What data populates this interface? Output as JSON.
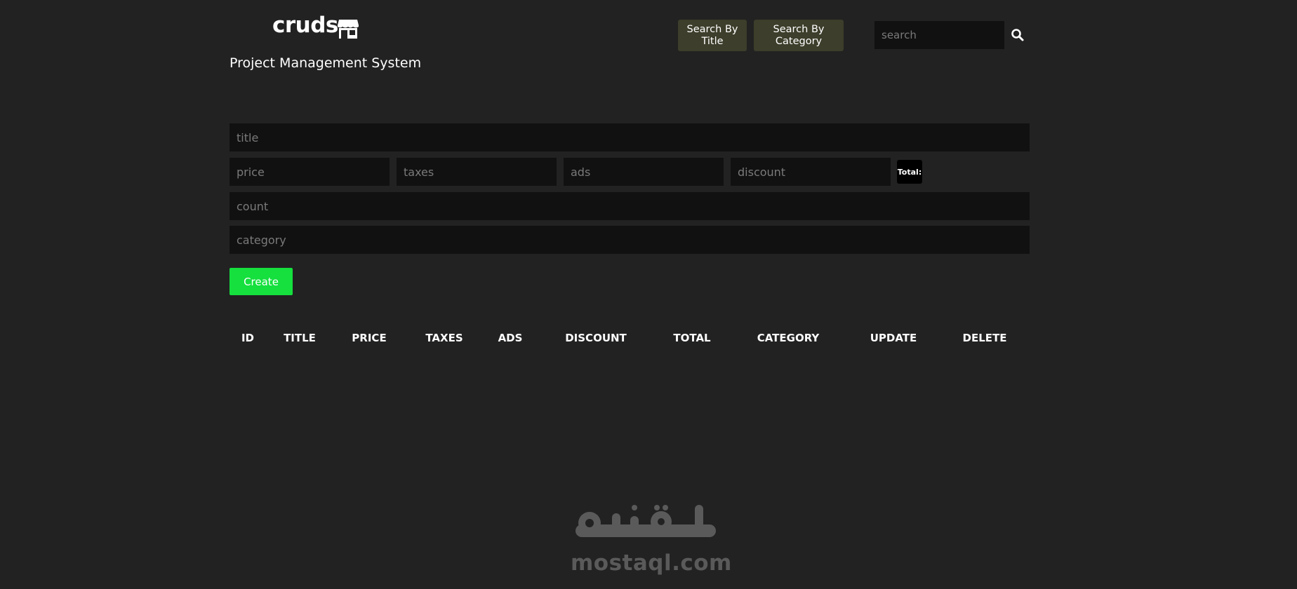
{
  "header": {
    "brand": "cruds",
    "brand_icon": "store-icon",
    "subtitle": "Project Management System",
    "search_by_title_label": "Search By\nTitle",
    "search_by_category_label": "Search By\nCategory",
    "search_placeholder": "search",
    "search_icon": "search-icon"
  },
  "form": {
    "title_placeholder": "title",
    "price_placeholder": "price",
    "taxes_placeholder": "taxes",
    "ads_placeholder": "ads",
    "discount_placeholder": "discount",
    "total_label": "Total:",
    "count_placeholder": "count",
    "category_placeholder": "category",
    "create_label": "Create"
  },
  "table": {
    "headers": [
      "ID",
      "TITLE",
      "PRICE",
      "TAXES",
      "ADS",
      "DISCOUNT",
      "TOTAL",
      "CATEGORY",
      "UPDATE",
      "DELETE"
    ]
  },
  "watermark": {
    "arabic": "مستقل",
    "latin": "mostaql.com"
  },
  "colors": {
    "background": "#222222",
    "input_bg": "#111111",
    "nav_button_bg": "#3d3e2b",
    "create_button_bg": "#15e03e",
    "total_bg": "#000000",
    "watermark": "#5a5a5a"
  }
}
